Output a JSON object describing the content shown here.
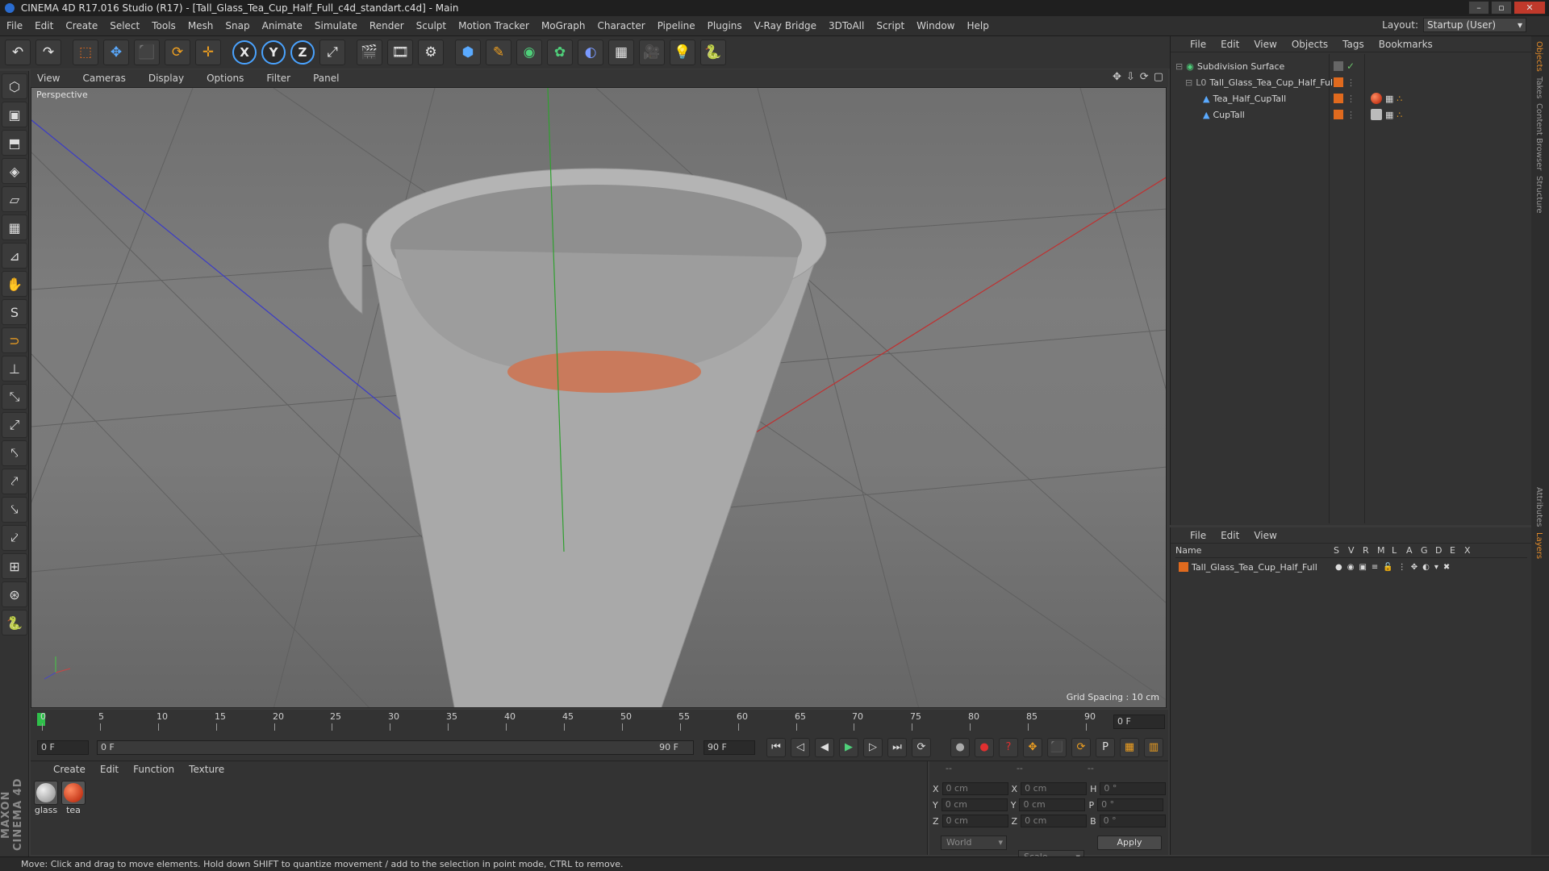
{
  "window": {
    "title": "CINEMA 4D R17.016 Studio (R17) - [Tall_Glass_Tea_Cup_Half_Full_c4d_standart.c4d] - Main",
    "min": "–",
    "max": "▫",
    "close": "✕"
  },
  "menu": [
    "File",
    "Edit",
    "Create",
    "Select",
    "Tools",
    "Mesh",
    "Snap",
    "Animate",
    "Simulate",
    "Render",
    "Sculpt",
    "Motion Tracker",
    "MoGraph",
    "Character",
    "Pipeline",
    "Plugins",
    "V-Ray Bridge",
    "3DToAll",
    "Script",
    "Window",
    "Help"
  ],
  "layout": {
    "label": "Layout:",
    "value": "Startup (User)"
  },
  "toolbar": {
    "undo": "↶",
    "redo": "↷",
    "select": "⬚",
    "move": "✥",
    "scale": "⬛",
    "rotate": "⟳",
    "add": "✛",
    "x": "X",
    "y": "Y",
    "z": "Z",
    "coord": "⤢",
    "render1": "🎬",
    "render2": "🎞",
    "render3": "⚙",
    "cube": "⬢",
    "pen": "✎",
    "subdiv": "◉",
    "array": "✿",
    "deform": "◐",
    "floor": "▦",
    "camera": "🎥",
    "light": "💡",
    "python": "🐍"
  },
  "left_tools": [
    "⬡",
    "▣",
    "⬒",
    "◈",
    "▱",
    "▦",
    "⊿",
    "✋",
    "S",
    "⊃",
    "⊥",
    "⤡",
    "⤢",
    "⤣",
    "⤤",
    "⤥",
    "⤦",
    "⊞",
    "⊛",
    "🐍"
  ],
  "maxon": "MAXON CINEMA 4D",
  "viewport": {
    "menu": [
      "View",
      "Cameras",
      "Display",
      "Options",
      "Filter",
      "Panel"
    ],
    "icons": [
      "✥",
      "⇩",
      "⟳",
      "▢"
    ],
    "label": "Perspective",
    "grid_spacing": "Grid Spacing : 10 cm"
  },
  "timeline": {
    "ticks": [
      "0",
      "5",
      "10",
      "15",
      "20",
      "25",
      "30",
      "35",
      "40",
      "45",
      "50",
      "55",
      "60",
      "65",
      "70",
      "75",
      "80",
      "85",
      "90"
    ],
    "current_frame": "0 F"
  },
  "transport": {
    "start": "0 F",
    "range_start": "0 F",
    "range_end": "90 F",
    "end": "90 F",
    "buttons": [
      "⏮",
      "◁",
      "◀",
      "▶",
      "▷",
      "⏭",
      "⟳"
    ]
  },
  "materials": {
    "menu": [
      "Create",
      "Edit",
      "Function",
      "Texture"
    ],
    "items": [
      {
        "label": "glass"
      },
      {
        "label": "tea"
      }
    ]
  },
  "coords": {
    "header": [
      "--",
      "--",
      "--"
    ],
    "rows": [
      {
        "a": "X",
        "av": "0 cm",
        "b": "X",
        "bv": "0 cm",
        "c": "H",
        "cv": "0 °"
      },
      {
        "a": "Y",
        "av": "0 cm",
        "b": "Y",
        "bv": "0 cm",
        "c": "P",
        "cv": "0 °"
      },
      {
        "a": "Z",
        "av": "0 cm",
        "b": "Z",
        "bv": "0 cm",
        "c": "B",
        "cv": "0 °"
      }
    ],
    "space": "World",
    "mode": "Scale",
    "apply": "Apply"
  },
  "objects": {
    "menu": [
      "File",
      "Edit",
      "View",
      "Objects",
      "Tags",
      "Bookmarks"
    ],
    "tree": [
      {
        "name": "Subdivision Surface",
        "indent": 0
      },
      {
        "name": "Tall_Glass_Tea_Cup_Half_Full",
        "indent": 1
      },
      {
        "name": "Tea_Half_CupTall",
        "indent": 2
      },
      {
        "name": "CupTall",
        "indent": 2
      }
    ]
  },
  "layers": {
    "menu": [
      "File",
      "Edit",
      "View"
    ],
    "columns": [
      "Name",
      "S",
      "V",
      "R",
      "M",
      "L",
      "A",
      "G",
      "D",
      "E",
      "X"
    ],
    "rows": [
      {
        "name": "Tall_Glass_Tea_Cup_Half_Full"
      }
    ]
  },
  "right_tabs": [
    "Objects",
    "Takes",
    "Content Browser",
    "Structure",
    "Attributes",
    "Layers"
  ],
  "status": "Move: Click and drag to move elements. Hold down SHIFT to quantize movement / add to the selection in point mode, CTRL to remove."
}
